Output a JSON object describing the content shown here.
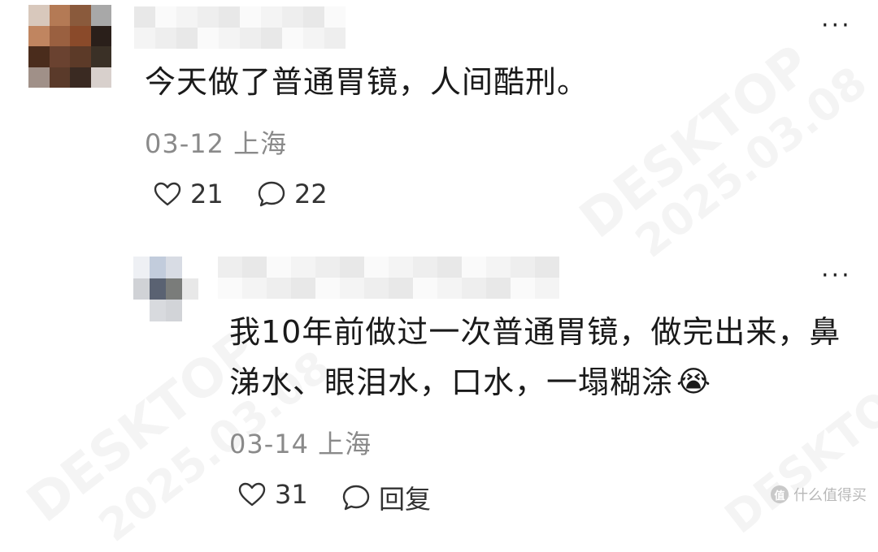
{
  "comments": [
    {
      "text": "今天做了普通胃镜，人间酷刑。",
      "date": "03-12",
      "location": "上海",
      "likes": "21",
      "replies": "22",
      "more": "···",
      "avatar_colors": [
        "#d8c8bc",
        "#b47a55",
        "#8a5a3c",
        "#a8a8a8",
        "#c08560",
        "#9a6040",
        "#8a4a2a",
        "#2a1f1a",
        "#4a2c1c",
        "#6a4230",
        "#5c3a28",
        "#3a3026",
        "#a09088",
        "#5a3a2a",
        "#3a2a22",
        "#d8d0cc"
      ]
    },
    {
      "text_line1": "我10年前做过一次普通胃镜，做完出来，鼻",
      "text_line2": "涕水、眼泪水，口水，一塌糊涂",
      "emoji": "😭",
      "date": "03-14",
      "location": "上海",
      "likes": "31",
      "reply_label": "回复",
      "more": "···",
      "avatar_colors": [
        "#eef0f4",
        "#c2ccdc",
        "#d8dce4",
        "#ffffff",
        "#d0d2d6",
        "#5a6272",
        "#7a7c7a",
        "#e8e8e8",
        "#ffffff",
        "#d8dade",
        "#d2d4d8",
        "#ffffff"
      ]
    }
  ],
  "watermark": {
    "text": "DESKTOP",
    "date": "2025.03.08"
  },
  "brand": {
    "name": "什么值得买",
    "badge": "值"
  }
}
